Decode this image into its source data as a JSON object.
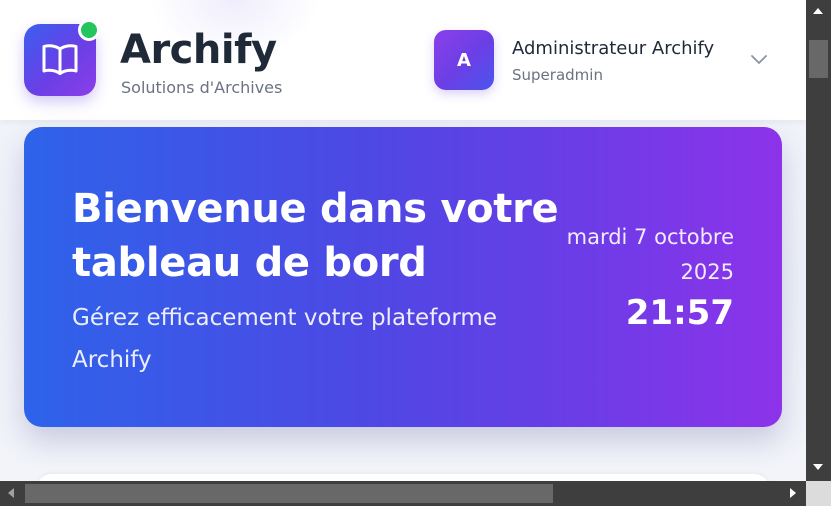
{
  "brand": {
    "name": "Archify",
    "tagline": "Solutions d'Archives",
    "logo_icon": "open-book-icon",
    "status_icon": "online-status-dot"
  },
  "user": {
    "avatar_initial": "A",
    "name": "Administrateur Archify",
    "role": "Superadmin",
    "menu_icon": "chevron-down-icon"
  },
  "hero": {
    "title": "Bienvenue dans votre tableau de bord",
    "subtitle": "Gérez efficacement votre plateforme Archify",
    "date": "mardi 7 octobre 2025",
    "time": "21:57"
  },
  "colors": {
    "accent_blue": "#2e63ea",
    "accent_purple": "#8d33ea",
    "online": "#22c55e"
  }
}
